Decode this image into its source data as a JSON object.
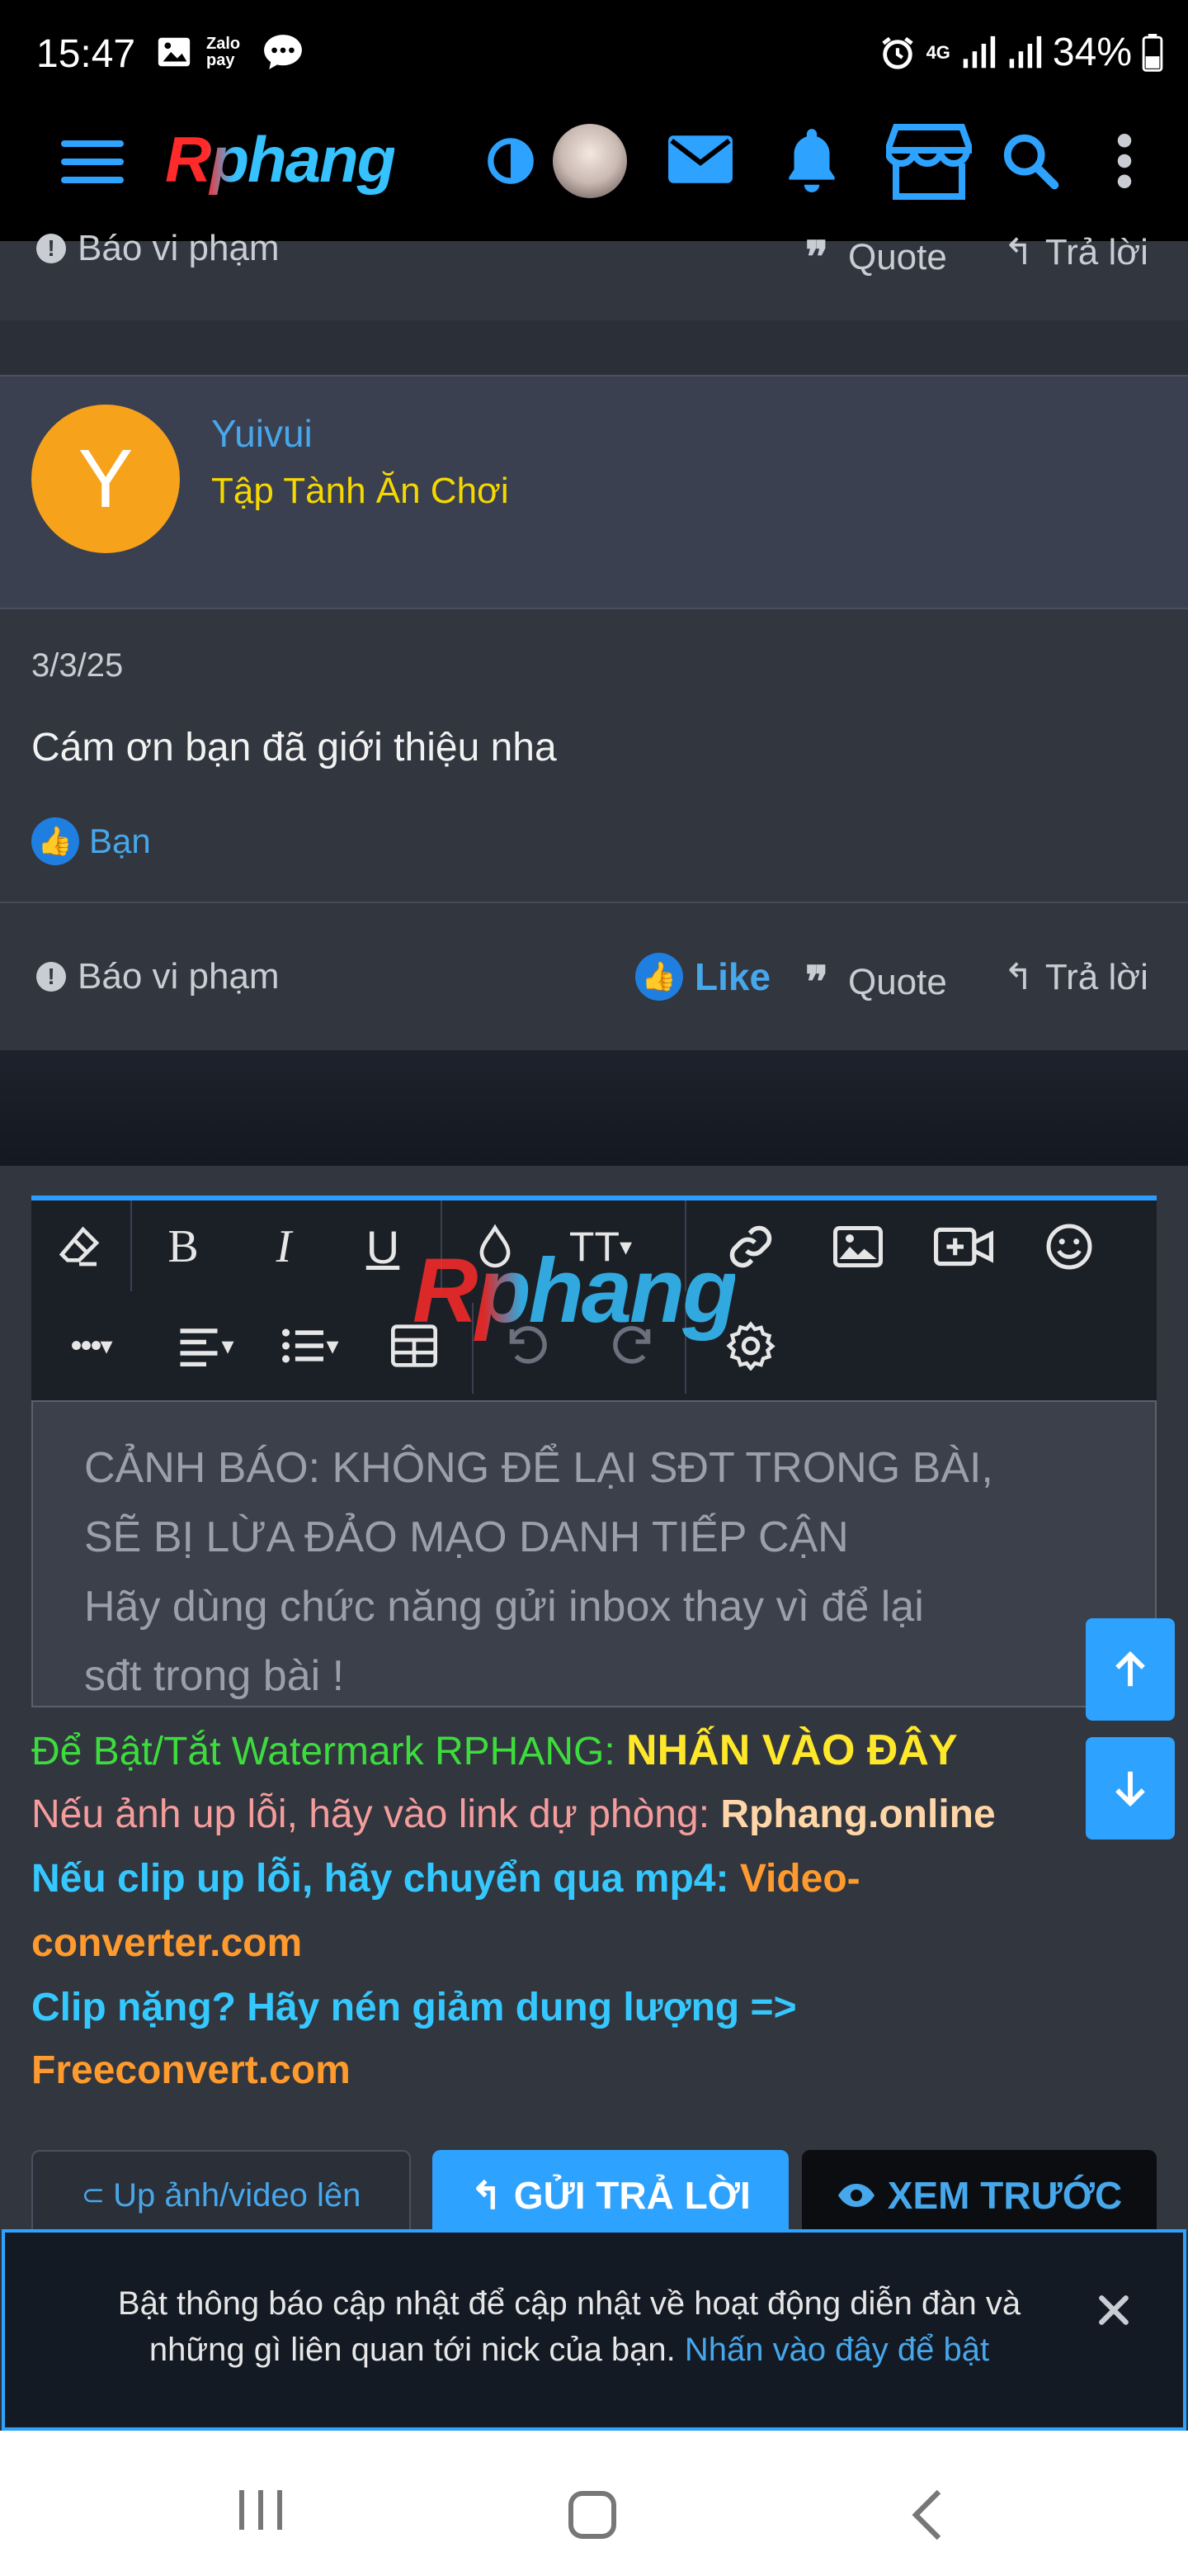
{
  "status": {
    "time": "15:47",
    "apps": "Zalo pay",
    "battery": "34%",
    "network": "4G"
  },
  "nav": {
    "logo": "Rphang"
  },
  "prev_post_footer": {
    "report": "Báo vi phạm",
    "quote": "Quote",
    "reply": "Trả lời"
  },
  "post": {
    "avatar_letter": "Y",
    "username": "Yuivui",
    "user_title": "Tập Tành Ăn Chơi",
    "date": "3/3/25",
    "content": "Cám ơn bạn đã giới thiệu nha",
    "reaction_user": "Bạn",
    "report": "Báo vi phạm",
    "like": "Like",
    "quote": "Quote",
    "reply": "Trả lời"
  },
  "editor": {
    "watermark": "Rphang",
    "placeholder_line1": "CẢNH BÁO: KHÔNG ĐỂ LẠI SĐT TRONG BÀI,",
    "placeholder_line2": "SẼ BỊ LỪA ĐẢO MẠO DANH TIẾP CẬN",
    "placeholder_line3": "Hãy dùng chức năng gửi inbox thay vì để lại",
    "placeholder_line4": "sđt trong bài !",
    "bold": "B",
    "italic": "I",
    "underline": "U",
    "text_size": "TT"
  },
  "notes": {
    "watermark_label": "Để Bật/Tắt Watermark RPHANG:",
    "watermark_link": "NHẤN VÀO ĐÂY",
    "image_label": "Nếu ảnh up lỗi, hãy vào link dự phòng:",
    "image_link": "Rphang.online",
    "clip_label": "Nếu clip up lỗi, hãy chuyển qua mp4:",
    "clip_link_1": "Video-",
    "clip_link_2": "converter.com",
    "heavy_label": "Clip nặng? Hãy nén giảm dung lượng =>",
    "heavy_link": "Freeconvert.com"
  },
  "buttons": {
    "upload": "Up ảnh/video lên",
    "submit": "GỬI TRẢ LỜI",
    "preview": "XEM TRƯỚC"
  },
  "notification": {
    "text": "Bật thông báo cập nhật để cập nhật về hoạt động diễn đàn và những gì liên quan tới nick của bạn.",
    "link": "Nhấn vào đây để bật"
  },
  "colors": {
    "accent": "#2ea2ff",
    "avatar": "#f7a21b",
    "user_title": "#f5d800",
    "note_green": "#3ddc3d",
    "note_pink": "#f59c9c",
    "note_cyan": "#35c8ff",
    "note_orange": "#ff9a2e"
  }
}
